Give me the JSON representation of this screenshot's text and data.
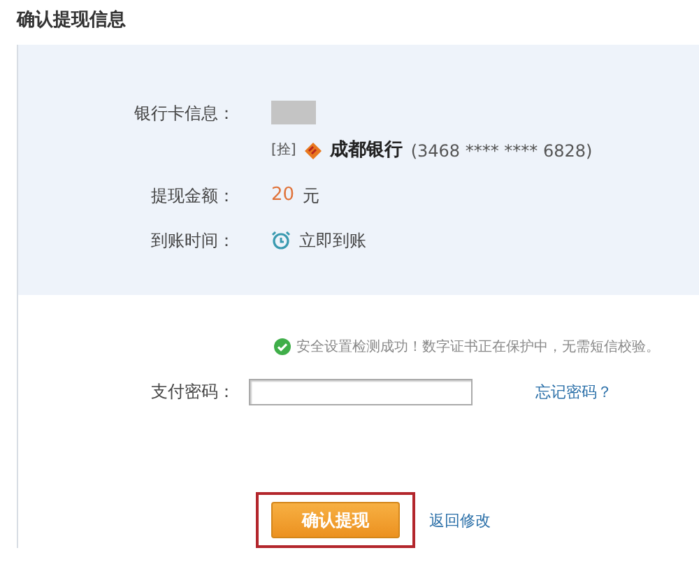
{
  "title": "确认提现信息",
  "info_rows": [
    {
      "kind": "card",
      "label": "银行卡信息：",
      "holder_masked": true,
      "card_type": "[拴]",
      "bank": "成都银行",
      "number": "(3468 **** **** 6828)"
    },
    {
      "kind": "amount",
      "label": "提现金额：",
      "amount": "20",
      "unit": "元"
    },
    {
      "kind": "arrival",
      "label": "到账时间：",
      "value": "立即到账"
    }
  ],
  "security_notice": "安全设置检测成功！数字证书正在保护中，无需短信校验。",
  "password": {
    "label": "支付密码：",
    "link": "忘记密码？"
  },
  "actions": {
    "confirm": "确认提现",
    "confirm_highlighted": true,
    "back": "返回修改"
  }
}
